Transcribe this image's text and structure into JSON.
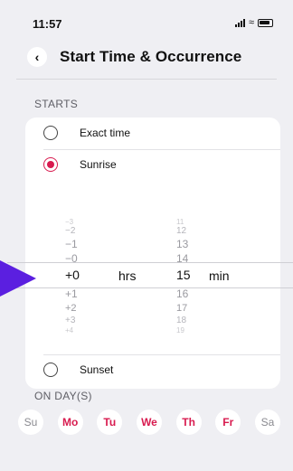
{
  "status_bar": {
    "time": "11:57"
  },
  "header": {
    "title": "Start Time & Occurrence"
  },
  "starts": {
    "section_label": "STARTS",
    "options": [
      {
        "label": "Exact time",
        "selected": false
      },
      {
        "label": "Sunrise",
        "selected": true
      },
      {
        "label": "Sunset",
        "selected": false
      }
    ],
    "picker": {
      "hours": [
        "−3",
        "−2",
        "−1",
        "−0",
        "+0",
        "+1",
        "+2",
        "+3",
        "+4"
      ],
      "hours_unit": "hrs",
      "minutes": [
        "11",
        "12",
        "13",
        "14",
        "15",
        "16",
        "17",
        "18",
        "19"
      ],
      "minutes_unit": "min",
      "selected_hours": "+0",
      "selected_minutes": "15"
    }
  },
  "on_days": {
    "section_label": "ON DAY(S)",
    "days": [
      {
        "label": "Su",
        "active": false
      },
      {
        "label": "Mo",
        "active": true
      },
      {
        "label": "Tu",
        "active": true
      },
      {
        "label": "We",
        "active": true
      },
      {
        "label": "Th",
        "active": true
      },
      {
        "label": "Fr",
        "active": true
      },
      {
        "label": "Sa",
        "active": false
      }
    ]
  },
  "colors": {
    "accent": "#d81b4f",
    "arrow": "#5b1fe0",
    "background": "#efeff3"
  }
}
